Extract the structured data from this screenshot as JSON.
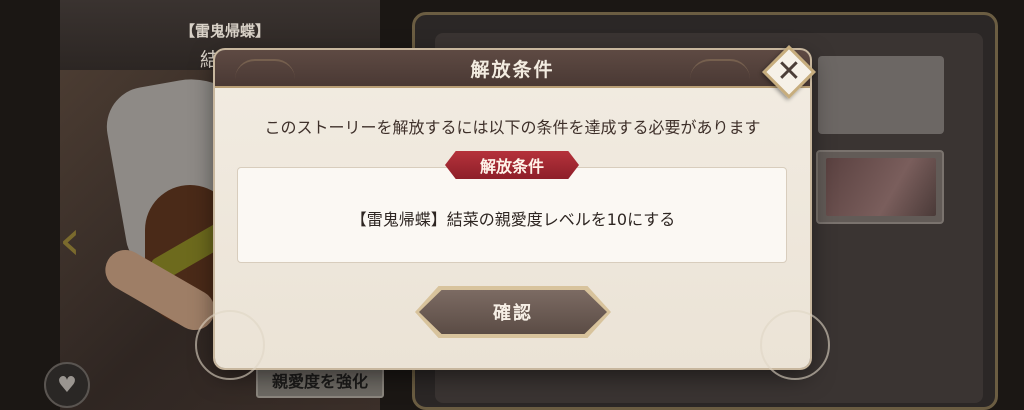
{
  "background": {
    "character_title": "【雷鬼帰蝶】",
    "character_name": "結菜",
    "affection_button_label": "親愛度を強化",
    "icons": {
      "left_arrow": "chevron-left-icon",
      "heart": "heart-icon"
    }
  },
  "modal": {
    "title": "解放条件",
    "message": "このストーリーを解放するには以下の条件を達成する必要があります",
    "condition_label": "解放条件",
    "condition_text": "【雷鬼帰蝶】結菜の親愛度レベルを10にする",
    "confirm_label": "確認",
    "close_icon": "close-icon"
  },
  "colors": {
    "header_bg": "#4a3934",
    "condition_label_bg": "#b5323b",
    "modal_bg": "#f2ece2",
    "confirm_bg": "#5b4c45",
    "accent_gold": "#c7ad7d"
  }
}
